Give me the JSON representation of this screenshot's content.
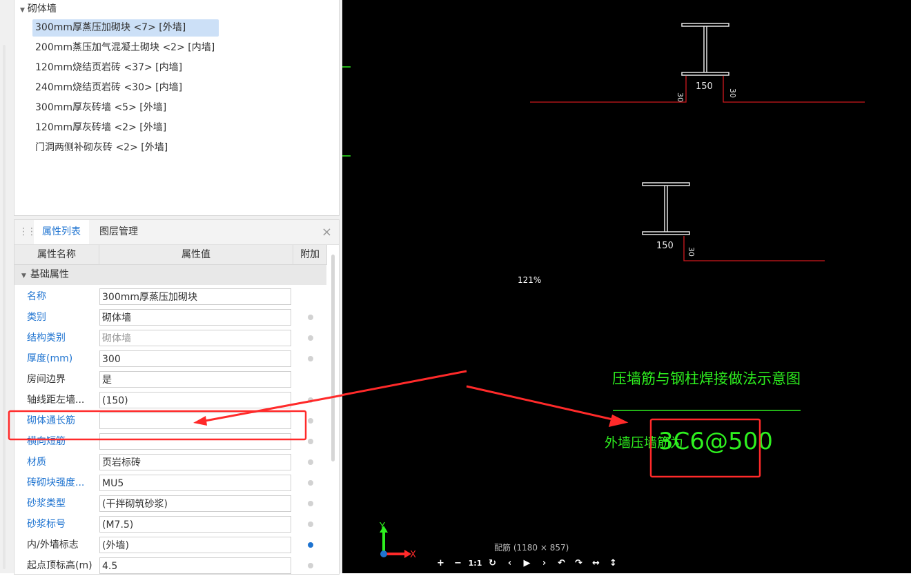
{
  "tree": {
    "group_label": "砌体墙",
    "items": [
      {
        "label": "300mm厚蒸压加砌块 <7> [外墙]",
        "selected": true
      },
      {
        "label": "200mm蒸压加气混凝土砌块 <2> [内墙]",
        "selected": false
      },
      {
        "label": "120mm烧结页岩砖 <37> [内墙]",
        "selected": false
      },
      {
        "label": "240mm烧结页岩砖 <30> [内墙]",
        "selected": false
      },
      {
        "label": "300mm厚灰砖墙 <5> [外墙]",
        "selected": false
      },
      {
        "label": "120mm厚灰砖墙 <2> [外墙]",
        "selected": false
      },
      {
        "label": "门洞两侧补砌灰砖 <2> [外墙]",
        "selected": false
      }
    ]
  },
  "props": {
    "tabs": [
      {
        "label": "属性列表",
        "active": true
      },
      {
        "label": "图层管理",
        "active": false
      }
    ],
    "close_glyph": "×",
    "columns": {
      "name": "属性名称",
      "value": "属性值",
      "extra": "附加"
    },
    "section_label": "基础属性",
    "rows": [
      {
        "name": "名称",
        "value": "300mm厚蒸压加砌块",
        "name_color": "blue",
        "dot": "none"
      },
      {
        "name": "类别",
        "value": "砌体墙",
        "name_color": "blue",
        "dot": "gray"
      },
      {
        "name": "结构类别",
        "value": "砌体墙",
        "name_color": "blue",
        "dot": "gray",
        "value_gray": true
      },
      {
        "name": "厚度(mm)",
        "value": "300",
        "name_color": "blue",
        "dot": "gray"
      },
      {
        "name": "房间边界",
        "value": "是",
        "name_color": "dark",
        "dot": "none"
      },
      {
        "name": "轴线距左墙...",
        "value": "(150)",
        "name_color": "dark",
        "dot": "gray"
      },
      {
        "name": "砌体通长筋",
        "value": "",
        "name_color": "blue",
        "dot": "gray"
      },
      {
        "name": "横向短筋",
        "value": "",
        "name_color": "blue",
        "dot": "gray"
      },
      {
        "name": "材质",
        "value": "页岩标砖",
        "name_color": "blue",
        "dot": "gray"
      },
      {
        "name": "砖砌块强度...",
        "value": "MU5",
        "name_color": "blue",
        "dot": "gray"
      },
      {
        "name": "砂浆类型",
        "value": "(干拌砌筑砂浆)",
        "name_color": "blue",
        "dot": "gray"
      },
      {
        "name": "砂浆标号",
        "value": "(M7.5)",
        "name_color": "blue",
        "dot": "gray"
      },
      {
        "name": "内/外墙标志",
        "value": "(外墙)",
        "name_color": "dark",
        "dot": "blue"
      },
      {
        "name": "起点顶标高(m)",
        "value": "4.5",
        "name_color": "dark",
        "dot": "gray"
      }
    ]
  },
  "viewer": {
    "zoom": "121%",
    "caption": "配筋 (1180 × 857)",
    "toolbar": [
      "+",
      "−",
      "1:1",
      "↻",
      "‹",
      "▶",
      "›",
      "↶",
      "↷",
      "↔",
      "↕"
    ],
    "drawing": {
      "dim_150_a": "150",
      "dim_30_a1": "30",
      "dim_30_a2": "30",
      "dim_150_b": "150",
      "dim_30_b": "30",
      "title": "压墙筋与钢柱焊接做法示意图",
      "note_prefix": "外墙压墙筋为",
      "note_value": "3C6@500",
      "axis_y": "Y",
      "axis_x": "X"
    }
  },
  "colors": {
    "accent_blue": "#1e73d0",
    "annotation_red": "#ff2a2a",
    "cad_green": "#2ef01f",
    "cad_red": "#d0181e"
  }
}
